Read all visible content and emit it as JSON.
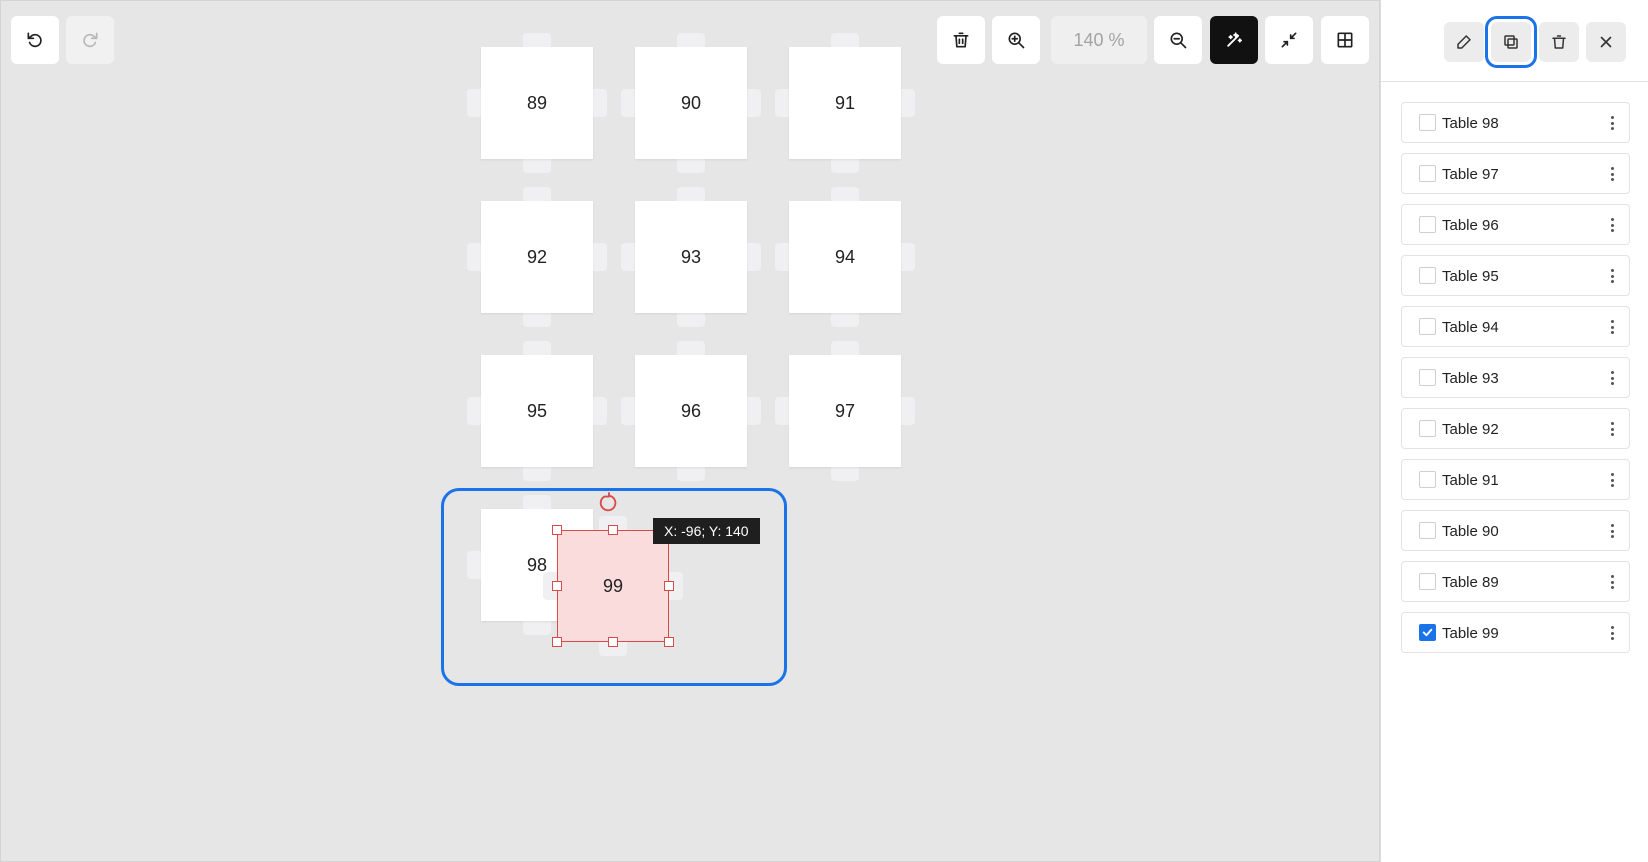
{
  "toolbar": {
    "zoom_level": "140 %",
    "icons": {
      "undo": "undo-icon",
      "redo": "redo-icon",
      "delete": "trash-icon",
      "zoom_in": "zoom-in-icon",
      "zoom_out": "zoom-out-icon",
      "magic": "magic-wand-icon",
      "collapse": "collapse-icon",
      "grid": "grid-icon"
    }
  },
  "canvas": {
    "tables": [
      "89",
      "90",
      "91",
      "92",
      "93",
      "94",
      "95",
      "96",
      "97",
      "98"
    ],
    "selected_table": "99",
    "coordinates": "X: -96; Y: 140"
  },
  "sidebar": {
    "icons": {
      "edit": "pencil-icon",
      "duplicate": "duplicate-icon",
      "delete": "trash-icon",
      "close": "close-icon"
    },
    "items": [
      {
        "label": "Table 98",
        "checked": false
      },
      {
        "label": "Table 97",
        "checked": false
      },
      {
        "label": "Table 96",
        "checked": false
      },
      {
        "label": "Table 95",
        "checked": false
      },
      {
        "label": "Table 94",
        "checked": false
      },
      {
        "label": "Table 93",
        "checked": false
      },
      {
        "label": "Table 92",
        "checked": false
      },
      {
        "label": "Table 91",
        "checked": false
      },
      {
        "label": "Table 90",
        "checked": false
      },
      {
        "label": "Table 89",
        "checked": false
      },
      {
        "label": "Table 99",
        "checked": true
      }
    ]
  },
  "colors": {
    "accent": "#1a73e8",
    "selection": "#d94a4a",
    "selection_fill": "#fadcdc",
    "canvas_bg": "#e6e6e6"
  }
}
